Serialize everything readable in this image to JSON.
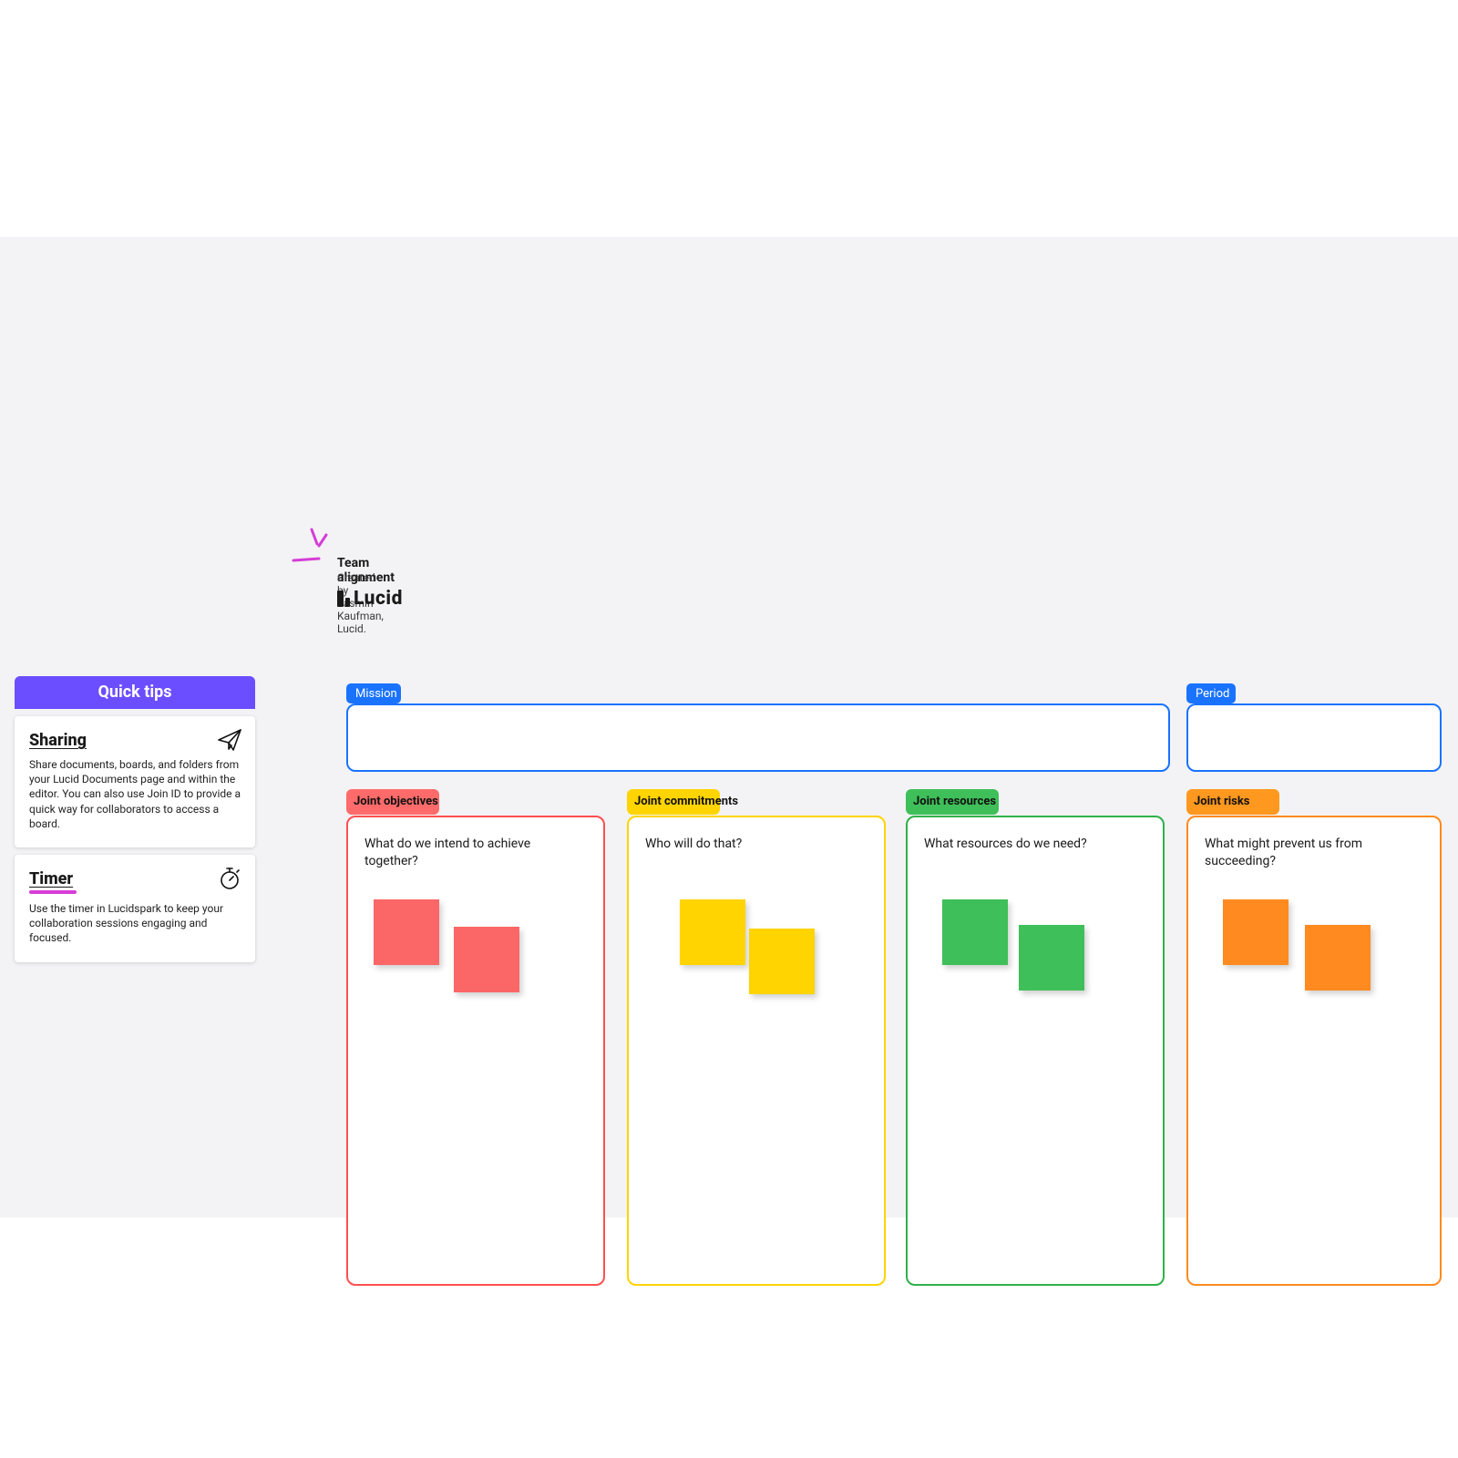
{
  "header": {
    "title": "Team alignment",
    "byline": "Created by Yasmin Kaufman, Lucid.",
    "logo_text": "Lucid"
  },
  "tips": {
    "header": "Quick tips",
    "cards": [
      {
        "title": "Sharing",
        "body": "Share documents, boards, and folders from your Lucid Documents page and within the editor. You can also use Join ID to provide a quick way for collaborators to access a board.",
        "icon": "paper-plane"
      },
      {
        "title": "Timer",
        "body": "Use the timer in Lucidspark to keep your collaboration sessions engaging and focused.",
        "icon": "stopwatch"
      }
    ]
  },
  "top": {
    "mission_label": "Mission",
    "period_label": "Period"
  },
  "columns": [
    {
      "tag": "Joint objectives",
      "prompt": "What do we intend to achieve together?",
      "color": "#ff4f4f",
      "notes": 2
    },
    {
      "tag": "Joint commitments",
      "prompt": "Who will do that?",
      "color": "#ffd400",
      "notes": 2
    },
    {
      "tag": "Joint resources",
      "prompt": "What resources do we need?",
      "color": "#2fb14a",
      "notes": 2
    },
    {
      "tag": "Joint risks",
      "prompt": "What might prevent us from succeeding?",
      "color": "#ff8a1f",
      "notes": 2
    }
  ]
}
